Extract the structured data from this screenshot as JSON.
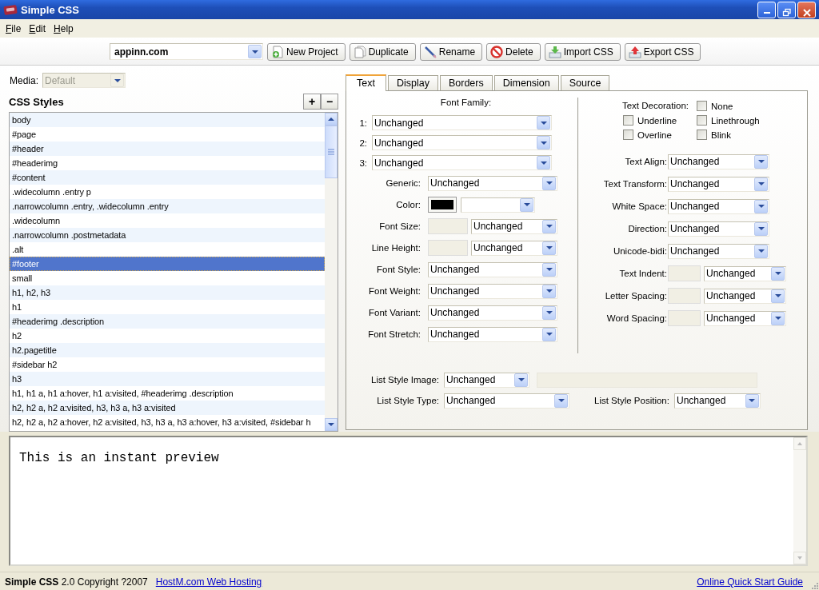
{
  "window": {
    "title": "Simple CSS"
  },
  "menu": [
    "File",
    "Edit",
    "Help"
  ],
  "toolbar": {
    "project": "appinn.com",
    "buttons": [
      {
        "label": "New Project",
        "kind": "new"
      },
      {
        "label": "Duplicate",
        "kind": "duplicate"
      },
      {
        "label": "Rename",
        "kind": "rename"
      },
      {
        "label": "Delete",
        "kind": "delete"
      },
      {
        "label": "Import CSS",
        "kind": "import"
      },
      {
        "label": "Export CSS",
        "kind": "export"
      }
    ]
  },
  "media": {
    "label": "Media:",
    "value": "Default",
    "disabled": true
  },
  "styles": {
    "title": "CSS Styles",
    "add": "+",
    "remove": "−",
    "items": [
      {
        "text": "body",
        "selected": false
      },
      {
        "text": "#page",
        "selected": false
      },
      {
        "text": "#header",
        "selected": false
      },
      {
        "text": "#headerimg",
        "selected": false
      },
      {
        "text": "#content",
        "selected": false
      },
      {
        "text": ".widecolumn .entry p",
        "selected": false
      },
      {
        "text": ".narrowcolumn .entry, .widecolumn .entry",
        "selected": false
      },
      {
        "text": ".widecolumn",
        "selected": false
      },
      {
        "text": ".narrowcolumn .postmetadata",
        "selected": false
      },
      {
        "text": ".alt",
        "selected": false
      },
      {
        "text": "#footer",
        "selected": true
      },
      {
        "text": "small",
        "selected": false
      },
      {
        "text": "h1, h2, h3",
        "selected": false
      },
      {
        "text": "h1",
        "selected": false
      },
      {
        "text": "#headerimg .description",
        "selected": false
      },
      {
        "text": "h2",
        "selected": false
      },
      {
        "text": "h2.pagetitle",
        "selected": false
      },
      {
        "text": "#sidebar h2",
        "selected": false
      },
      {
        "text": "h3",
        "selected": false
      },
      {
        "text": "h1, h1 a, h1 a:hover, h1 a:visited, #headerimg .description",
        "selected": false
      },
      {
        "text": "h2, h2 a, h2 a:visited, h3, h3 a, h3 a:visited",
        "selected": false
      },
      {
        "text": "h2, h2 a, h2 a:hover, h2 a:visited, h3, h3 a, h3 a:hover, h3 a:visited, #sidebar h",
        "selected": false
      }
    ]
  },
  "tabs": [
    {
      "label": "Text",
      "selected": true
    },
    {
      "label": "Display",
      "selected": false
    },
    {
      "label": "Borders",
      "selected": false
    },
    {
      "label": "Dimension",
      "selected": false
    },
    {
      "label": "Source",
      "selected": false
    }
  ],
  "font_family": {
    "title": "Font Family:",
    "slots": [
      {
        "label": "1:",
        "value": "Unchanged"
      },
      {
        "label": "2:",
        "value": "Unchanged"
      },
      {
        "label": "3:",
        "value": "Unchanged"
      }
    ]
  },
  "left_fields": [
    {
      "label": "Generic:",
      "kind": "select",
      "value": "Unchanged"
    },
    {
      "label": "Color:",
      "kind": "color",
      "color": "#000000"
    },
    {
      "label": "Font Size:",
      "kind": "measure",
      "value": "Unchanged"
    },
    {
      "label": "Line Height:",
      "kind": "measure",
      "value": "Unchanged"
    },
    {
      "label": "Font Style:",
      "kind": "select",
      "value": "Unchanged"
    },
    {
      "label": "Font Weight:",
      "kind": "select",
      "value": "Unchanged"
    },
    {
      "label": "Font Variant:",
      "kind": "select",
      "value": "Unchanged"
    },
    {
      "label": "Font Stretch:",
      "kind": "select",
      "value": "Unchanged"
    }
  ],
  "text_decoration": {
    "label": "Text Decoration:",
    "options": [
      {
        "label": "None",
        "checked": false
      },
      {
        "label": "Underline",
        "checked": false
      },
      {
        "label": "Linethrough",
        "checked": false
      },
      {
        "label": "Overline",
        "checked": false
      },
      {
        "label": "Blink",
        "checked": false
      }
    ]
  },
  "right_fields": [
    {
      "label": "Text Align:",
      "kind": "select",
      "value": "Unchanged"
    },
    {
      "label": "Text Transform:",
      "kind": "select",
      "value": "Unchanged"
    },
    {
      "label": "White Space:",
      "kind": "select",
      "value": "Unchanged"
    },
    {
      "label": "Direction:",
      "kind": "select",
      "value": "Unchanged"
    },
    {
      "label": "Unicode-bidi:",
      "kind": "select",
      "value": "Unchanged"
    },
    {
      "label": "Text Indent:",
      "kind": "measure",
      "value": "Unchanged"
    },
    {
      "label": "Letter Spacing:",
      "kind": "measure",
      "value": "Unchanged"
    },
    {
      "label": "Word Spacing:",
      "kind": "measure",
      "value": "Unchanged"
    }
  ],
  "list_style": {
    "image": {
      "label": "List Style Image:",
      "value": "Unchanged",
      "url_disabled": true
    },
    "type": {
      "label": "List Style Type:",
      "value": "Unchanged"
    },
    "position": {
      "label": "List Style Position:",
      "value": "Unchanged"
    }
  },
  "preview": {
    "text": "This is an instant preview"
  },
  "status_bar": {
    "about": "**Simple CSS** 2.0 Copyright ?2007",
    "link": "HostM.com Web Hosting",
    "help_link": "Online Quick Start Guide"
  }
}
